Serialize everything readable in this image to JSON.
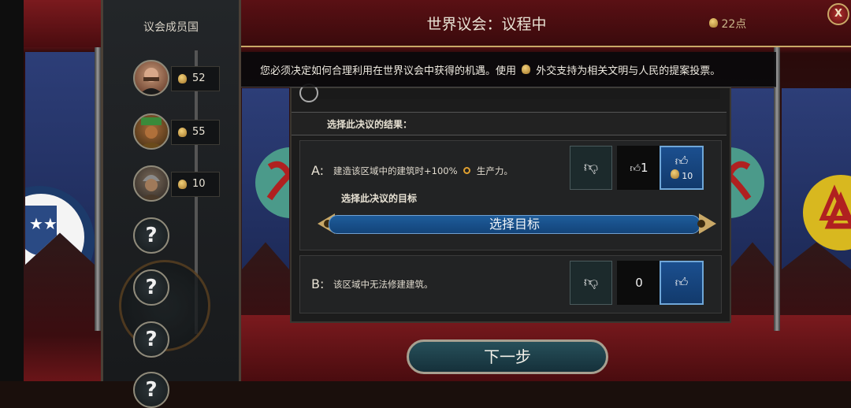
{
  "header": {
    "title": "世界议会：议程中",
    "points": "22点",
    "close_label": "X"
  },
  "instruction": {
    "text_before": "您必须决定如何合理利用在世界议会中获得的机遇。使用",
    "text_after": "外交支持为相关文明与人民的提案投票。"
  },
  "sidebar": {
    "title": "议会成员国",
    "members": [
      {
        "value": "52"
      },
      {
        "value": "55"
      },
      {
        "value": "10"
      }
    ],
    "unknown_label": "?"
  },
  "proposal": {
    "section_label": "选择此决议的结果：",
    "options": [
      {
        "letter": "A:",
        "text_before": "建造该区域中的建筑时+100%",
        "text_after": "生产力。",
        "vote_count": "1",
        "upvote_cost": "10",
        "target_label": "选择此决议的目标",
        "target_button": "选择目标"
      },
      {
        "letter": "B:",
        "text": "该区域中无法修建建筑。",
        "vote_count": "0"
      }
    ]
  },
  "footer": {
    "next_label": "下一步"
  },
  "colors": {
    "accent_gold": "#c9a867",
    "vote_blue": "#1b4f8f",
    "banner_blue": "#2d3e78",
    "wall_red": "#7b1a1e"
  }
}
